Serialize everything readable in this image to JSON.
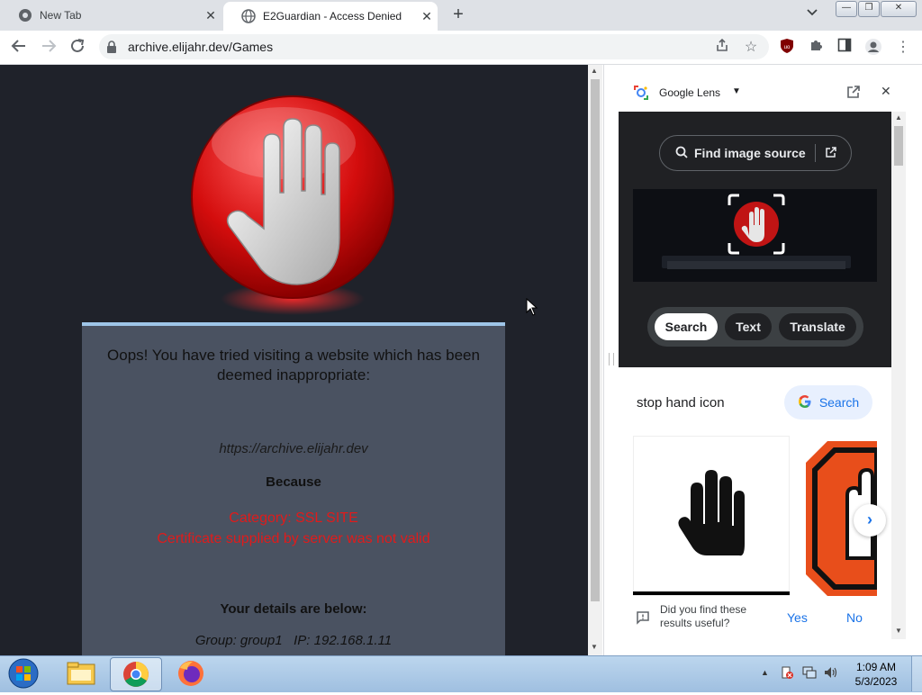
{
  "tabs": [
    {
      "title": "New Tab",
      "active": false
    },
    {
      "title": "E2Guardian - Access Denied",
      "active": true
    }
  ],
  "window_controls": {
    "minimize": "—",
    "maximize": "❐",
    "close": "✕"
  },
  "address_bar": {
    "url": "archive.elijahr.dev/Games"
  },
  "page": {
    "heading": "Oops! You have tried visiting a website which has been deemed inappropriate:",
    "blocked_url": "https://archive.elijahr.dev",
    "because_label": "Because",
    "reason_line1": "Category: SSL SITE",
    "reason_line2": "Certificate supplied by server was not valid",
    "details_heading": "Your details are below:",
    "details_line": "Group: group1   IP: 192.168.1.11"
  },
  "lens": {
    "title": "Google Lens",
    "find_source_label": "Find image source",
    "modes": [
      "Search",
      "Text",
      "Translate"
    ],
    "active_mode": "Search",
    "query": "stop hand icon",
    "search_button": "Search",
    "feedback_question": "Did you find these results useful?",
    "feedback_yes": "Yes",
    "feedback_no": "No"
  },
  "taskbar": {
    "time": "1:09 AM",
    "date": "5/3/2023"
  },
  "colors": {
    "accent_blue": "#1a73e8",
    "error_red": "#e01b1b",
    "page_bg": "#1f222a"
  }
}
